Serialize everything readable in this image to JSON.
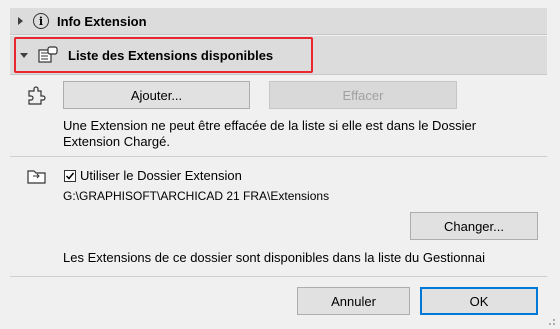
{
  "sections": {
    "info": {
      "title": "Info Extension"
    },
    "list": {
      "title": "Liste des Extensions disponibles"
    }
  },
  "buttons": {
    "add": "Ajouter...",
    "remove": "Effacer",
    "change": "Changer...",
    "cancel": "Annuler",
    "ok": "OK"
  },
  "texts": {
    "remove_info": "Une Extension ne peut être effacée de la liste si elle est dans le Dossier Extension Chargé.",
    "use_folder_label": "Utiliser le Dossier Extension",
    "folder_path": "G:\\GRAPHISOFT\\ARCHICAD 21 FRA\\Extensions",
    "folder_info": "Les Extensions de ce dossier sont disponibles dans la liste du Gestionnai"
  },
  "state": {
    "use_folder_checked": true
  },
  "colors": {
    "highlight": "#e8262e",
    "accent": "#0078d7"
  }
}
